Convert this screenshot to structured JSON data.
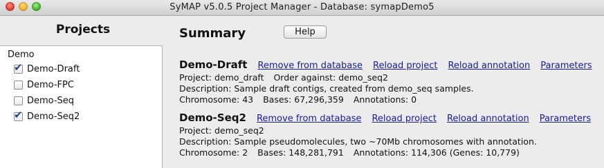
{
  "window": {
    "title": "SyMAP v5.0.5 Project Manager - Database: symapDemo5"
  },
  "projects_panel": {
    "heading": "Projects",
    "group": "Demo",
    "items": [
      {
        "label": "Demo-Draft",
        "checked": true
      },
      {
        "label": "Demo-FPC",
        "checked": false
      },
      {
        "label": "Demo-Seq",
        "checked": false
      },
      {
        "label": "Demo-Seq2",
        "checked": true
      }
    ]
  },
  "summary": {
    "heading": "Summary",
    "help_label": "Help",
    "projects": [
      {
        "name": "Demo-Draft",
        "links": {
          "remove": "Remove from database",
          "reload": "Reload project",
          "annotation": "Reload annotation",
          "parameters": "Parameters"
        },
        "project_line": "Project: demo_draft",
        "order_line": "Order against: demo_seq2",
        "description": "Description: Sample draft contigs, created from demo_seq samples.",
        "chromosome": "Chromosome: 43",
        "bases": "Bases: 67,296,359",
        "annotations": "Annotations: 0"
      },
      {
        "name": "Demo-Seq2",
        "links": {
          "remove": "Remove from database",
          "reload": "Reload project",
          "annotation": "Reload annotation",
          "parameters": "Parameters"
        },
        "project_line": "Project: demo_seq2",
        "description": "Description: Sample pseudomolecules, two ~70Mb chromosomes with annotation.",
        "chromosome": "Chromosome: 2",
        "bases": "Bases: 148,281,791",
        "annotations": "Annotations: 114,306 (Genes: 10,779)"
      }
    ]
  }
}
